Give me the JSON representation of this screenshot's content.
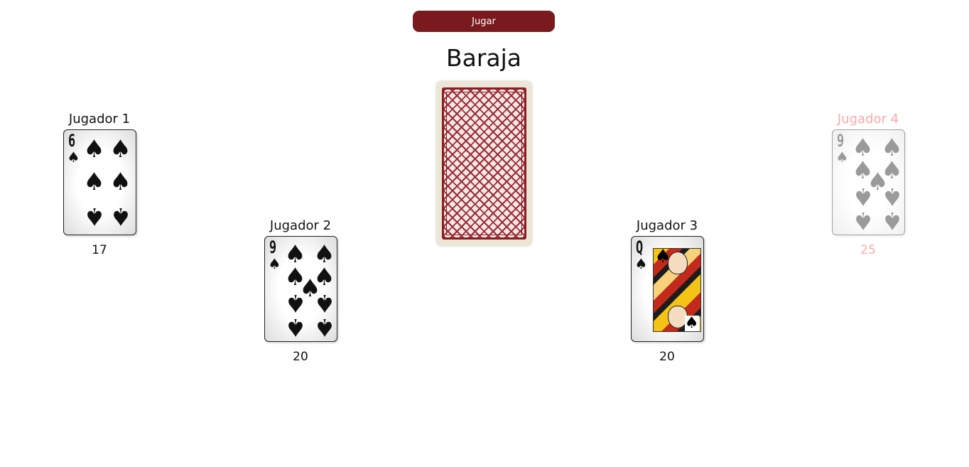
{
  "controls": {
    "play_label": "Jugar"
  },
  "deck": {
    "title": "Baraja"
  },
  "players": [
    {
      "name": "Jugador 1",
      "card": {
        "rank": "6",
        "suit": "spades"
      },
      "score": "17",
      "active": true
    },
    {
      "name": "Jugador 2",
      "card": {
        "rank": "9",
        "suit": "spades"
      },
      "score": "20",
      "active": true
    },
    {
      "name": "Jugador 3",
      "card": {
        "rank": "Q",
        "suit": "spades"
      },
      "score": "20",
      "active": true
    },
    {
      "name": "Jugador 4",
      "card": {
        "rank": "9",
        "suit": "spades"
      },
      "score": "25",
      "active": false
    }
  ],
  "colors": {
    "button": "#7a1a1e",
    "deck_pattern": "#9d2b35",
    "inactive_text": "#ff3030"
  },
  "icons": {
    "suit": "spade-icon",
    "deck_back": "card-back-pattern"
  }
}
